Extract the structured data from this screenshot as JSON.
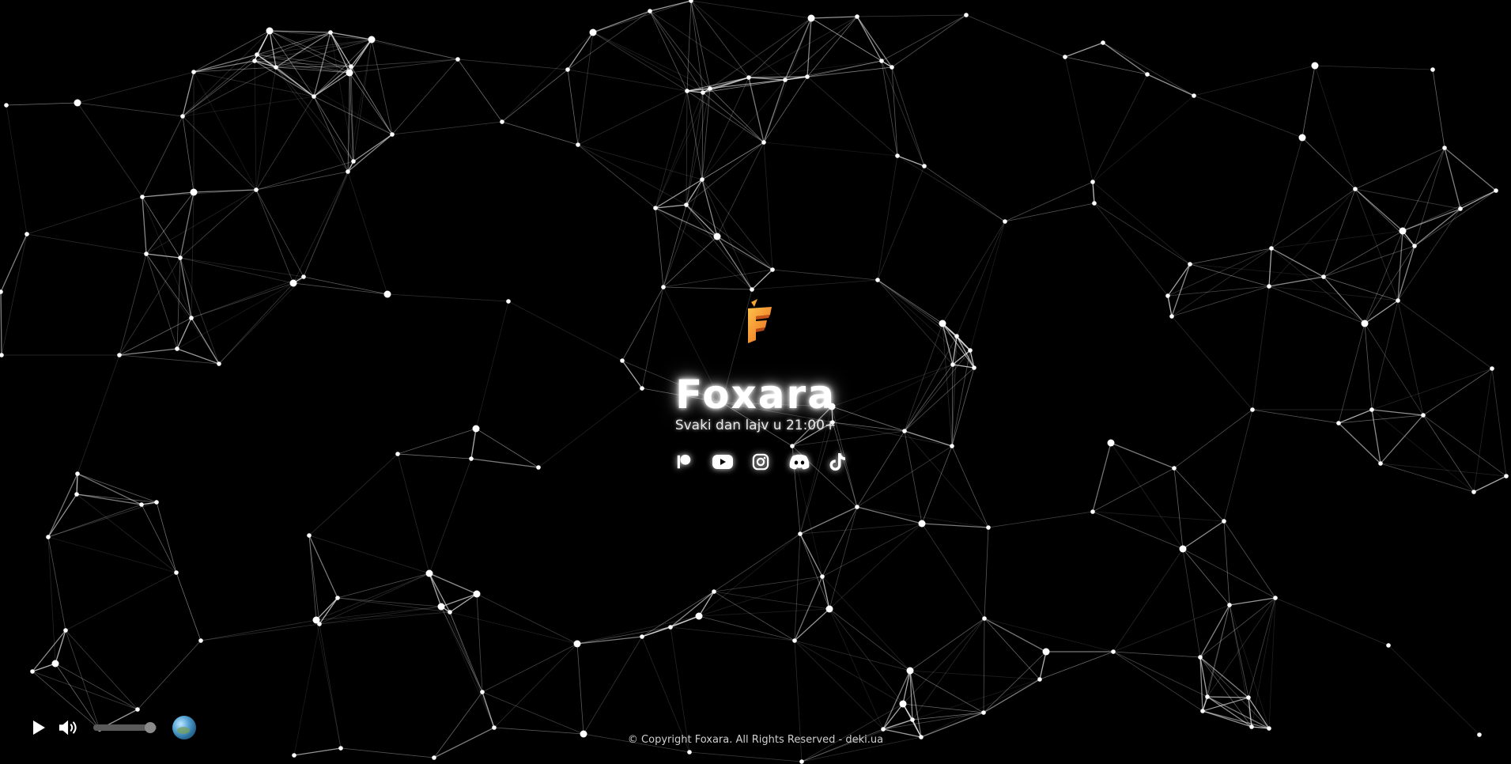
{
  "brand": {
    "title": "Foxara",
    "tagline": "Svaki dan lajv u 21:00+",
    "logo_letter": "F"
  },
  "socials": [
    {
      "name": "patreon",
      "icon": "patreon-icon"
    },
    {
      "name": "youtube",
      "icon": "youtube-icon"
    },
    {
      "name": "instagram",
      "icon": "instagram-icon"
    },
    {
      "name": "discord",
      "icon": "discord-icon"
    },
    {
      "name": "tiktok",
      "icon": "tiktok-icon"
    }
  ],
  "player": {
    "play_icon": "play-icon",
    "volume_icon": "volume-icon",
    "volume_level": 0.9,
    "globe_icon": "globe-icon"
  },
  "footer": {
    "copyright": "© Copyright Foxara. All Rights Reserved - deki.ua"
  },
  "colors": {
    "background": "#000000",
    "network": "#ffffff",
    "logo_orange": "#f28c1e",
    "logo_yellow": "#ffc24a"
  }
}
